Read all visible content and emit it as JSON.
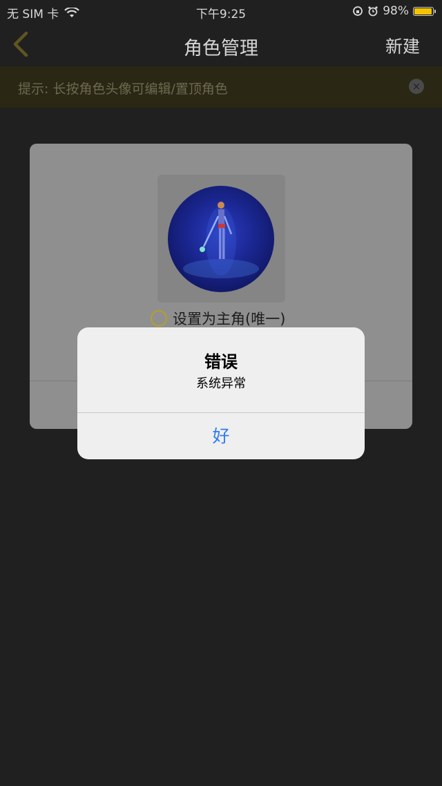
{
  "status_bar": {
    "carrier": "无 SIM 卡",
    "time": "下午9:25",
    "battery": "98%",
    "battery_level": 0.98,
    "battery_color": "#f3c400"
  },
  "nav": {
    "title": "角色管理",
    "right_action": "新建",
    "back_icon": "chevron-left-icon",
    "accent_color": "#b59f2a"
  },
  "tip": {
    "text": "提示: 长按角色头像可编辑/置顶角色",
    "close_icon": "close-icon"
  },
  "character_card": {
    "set_main_label": "设置为主角(唯一)"
  },
  "alert": {
    "title": "错误",
    "message": "系统异常",
    "button_label": "好",
    "button_color": "#2f7bf5"
  }
}
